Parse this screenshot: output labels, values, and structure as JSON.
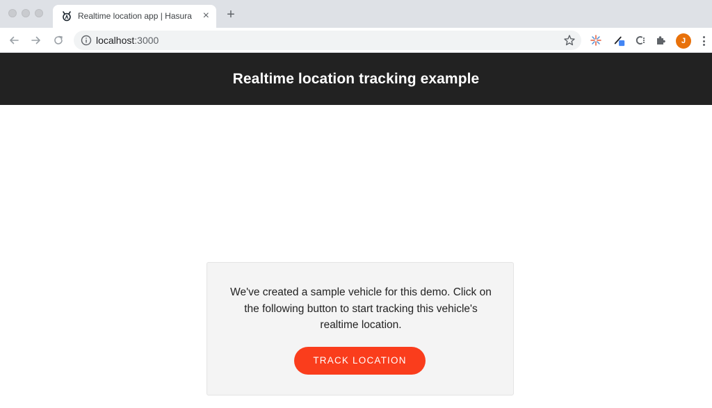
{
  "browser": {
    "tab": {
      "title": "Realtime location app | Hasura",
      "close_glyph": "×",
      "favicon": "hasura-logo-icon"
    },
    "new_tab_glyph": "+",
    "omnibox": {
      "url_host": "localhost",
      "url_port": ":3000"
    },
    "profile_initial": "J",
    "profile_color": "#e8710a"
  },
  "app": {
    "header_title": "Realtime location tracking example",
    "header_bg": "#222222",
    "card": {
      "message": "We've created a sample vehicle for this demo. Click on the following button to start tracking this vehicle's realtime location.",
      "button_label": "TRACK LOCATION",
      "button_color": "#fa3d1c"
    }
  }
}
